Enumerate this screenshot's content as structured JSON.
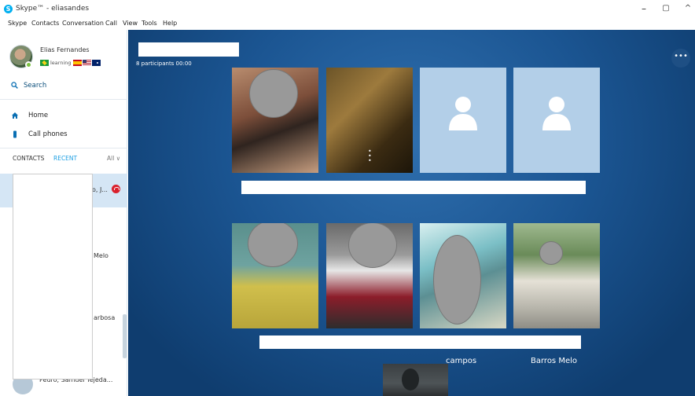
{
  "window": {
    "title": "Skype™ - eliasandes",
    "minimize": "–",
    "restore": "▢",
    "collapse": "^"
  },
  "menu": [
    "Skype",
    "Contacts",
    "Conversation",
    "Call",
    "View",
    "Tools",
    "Help"
  ],
  "profile": {
    "name": "Elias Fernandes",
    "mood": "learning"
  },
  "sidebar": {
    "search_label": "Search",
    "nav": [
      {
        "label": "Home"
      },
      {
        "label": "Call phones"
      }
    ],
    "tabs": {
      "contacts": "CONTACTS",
      "recent": "RECENT",
      "all": "All ∨"
    }
  },
  "recent_list": {
    "snippets": [
      "o, J...",
      "Melo",
      "arbosa",
      "Pedro, Samuel Tejeda..."
    ]
  },
  "call": {
    "participants_info": "8 participants  00:00",
    "more_label": "•••",
    "tile_names": [
      "campos",
      "Barros Melo"
    ]
  },
  "colors": {
    "accent": "#00aff0",
    "call_bg": "#1b5592",
    "hangup_red": "#d9202c",
    "presence_green": "#7cc242"
  }
}
